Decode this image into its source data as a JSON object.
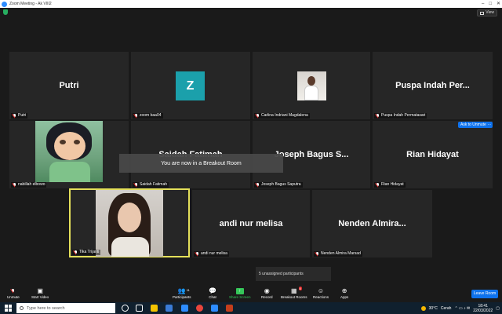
{
  "window": {
    "title": "Zoom Meeting - Ak VIII2"
  },
  "view_button": {
    "label": "View"
  },
  "tiles": {
    "putri": {
      "center_name": "Putri",
      "label": "Putri"
    },
    "zoom": {
      "avatar_letter": "Z",
      "label": "zoom baa04",
      "avatar_color": "#1ba0ab"
    },
    "carlina": {
      "label": "Carlina Indriani Magdalena"
    },
    "puspa": {
      "center_name": "Puspa Indah Per...",
      "label": "Puspa Indah Permatasari"
    },
    "nabillah": {
      "label": "nabillah elbowo"
    },
    "saidah": {
      "center_name": "Saidah Fatimah",
      "label": "Saidah Fatimah"
    },
    "joseph": {
      "center_name": "Joseph Bagus S...",
      "label": "Joseph Bagus Saputra"
    },
    "rian": {
      "center_name": "Rian Hidayat",
      "label": "Rian Hidayat",
      "ask_unmute": "Ask to Unmute",
      "more": "..."
    },
    "tika": {
      "label": "Tika Trijanti",
      "highlight_color": "#e4e05a"
    },
    "andi": {
      "center_name": "andi nur melisa",
      "label": "andi nur melisa"
    },
    "nenden": {
      "center_name": "Nenden Almira...",
      "label": "Nenden Almira Marsad"
    }
  },
  "breakout_notice": "You are now in a Breakout Room",
  "unassigned": "5 unassigned participants",
  "toolbar": {
    "unmute": "Unmute",
    "start_video": "Start Video",
    "participants": "Participants",
    "participants_count": "11",
    "chat": "Chat",
    "share_screen": "Share Screen",
    "record": "Record",
    "breakout_rooms": "Breakout Rooms",
    "breakout_badge": "8",
    "reactions": "Reactions",
    "apps": "Apps",
    "leave": "Leave Room"
  },
  "taskbar": {
    "search_placeholder": "Type here to search",
    "weather_temp": "30°C",
    "weather_text": "Cerah",
    "time": "18:41",
    "date": "22/03/2022"
  }
}
